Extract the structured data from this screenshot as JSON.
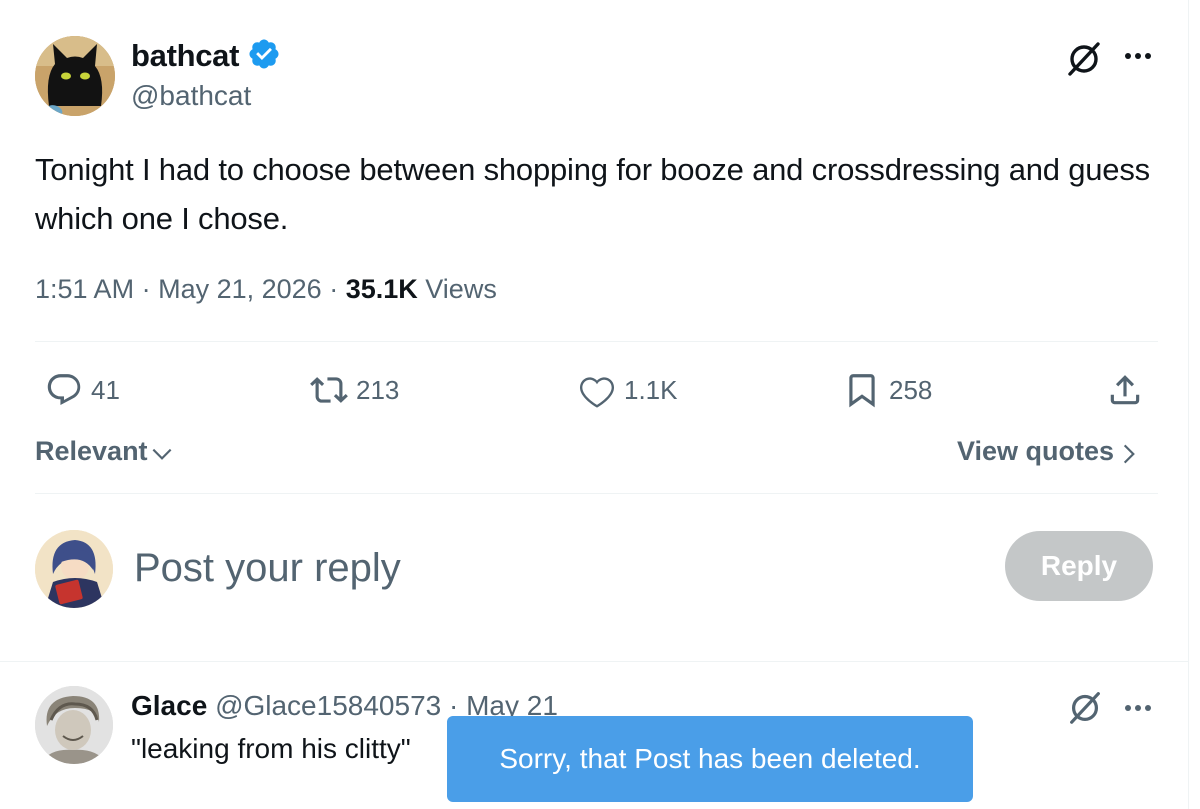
{
  "post": {
    "author_name": "bathcat",
    "author_handle": "@bathcat",
    "text": "Tonight I had to choose between shopping for booze and crossdressing and guess which one I chose.",
    "time": "1:51 AM",
    "date": "May 21, 2026",
    "views_count": "35.1K",
    "views_label": "Views"
  },
  "actions": {
    "replies": "41",
    "reposts": "213",
    "likes": "1.1K",
    "bookmarks": "258"
  },
  "sort": {
    "label": "Relevant",
    "view_quotes_label": "View quotes"
  },
  "composer": {
    "placeholder": "Post your reply",
    "reply_button": "Reply"
  },
  "reply": {
    "name": "Glace",
    "handle": "@Glace15840573",
    "date": "May 21",
    "text": "\"leaking from his clitty\""
  },
  "toast": {
    "message": "Sorry, that Post has been deleted."
  },
  "colors": {
    "verified_badge": "#1d9bf0",
    "secondary_text": "#536471",
    "reply_button_disabled": "#c4c7c8",
    "toast_background": "#4a9ee8"
  },
  "icons": [
    "verified-badge-icon",
    "grok-icon",
    "more-icon",
    "reply-icon",
    "repost-icon",
    "like-icon",
    "bookmark-icon",
    "share-icon",
    "chevron-down-icon",
    "chevron-right-icon"
  ]
}
